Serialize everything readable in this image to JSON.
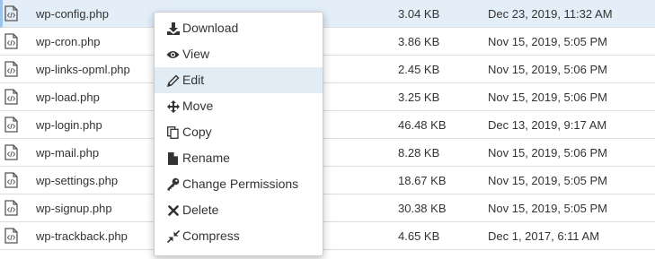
{
  "files": [
    {
      "name": "wp-config.php",
      "size": "3.04 KB",
      "date": "Dec 23, 2019, 11:32 AM",
      "selected": true
    },
    {
      "name": "wp-cron.php",
      "size": "3.86 KB",
      "date": "Nov 15, 2019, 5:05 PM"
    },
    {
      "name": "wp-links-opml.php",
      "size": "2.45 KB",
      "date": "Nov 15, 2019, 5:06 PM"
    },
    {
      "name": "wp-load.php",
      "size": "3.25 KB",
      "date": "Nov 15, 2019, 5:06 PM"
    },
    {
      "name": "wp-login.php",
      "size": "46.48 KB",
      "date": "Dec 13, 2019, 9:17 AM"
    },
    {
      "name": "wp-mail.php",
      "size": "8.28 KB",
      "date": "Nov 15, 2019, 5:06 PM"
    },
    {
      "name": "wp-settings.php",
      "size": "18.67 KB",
      "date": "Nov 15, 2019, 5:05 PM"
    },
    {
      "name": "wp-signup.php",
      "size": "30.38 KB",
      "date": "Nov 15, 2019, 5:05 PM"
    },
    {
      "name": "wp-trackback.php",
      "size": "4.65 KB",
      "date": "Dec 1, 2017, 6:11 AM"
    }
  ],
  "file_icon": "code-file-icon",
  "context_menu": {
    "highlighted": "Edit",
    "items": [
      {
        "label": "Download",
        "icon": "download-icon"
      },
      {
        "label": "View",
        "icon": "eye-icon"
      },
      {
        "label": "Edit",
        "icon": "pencil-icon"
      },
      {
        "label": "Move",
        "icon": "move-arrows-icon"
      },
      {
        "label": "Copy",
        "icon": "copy-icon"
      },
      {
        "label": "Rename",
        "icon": "file-icon"
      },
      {
        "label": "Change Permissions",
        "icon": "key-icon"
      },
      {
        "label": "Delete",
        "icon": "x-icon"
      },
      {
        "label": "Compress",
        "icon": "compress-icon"
      }
    ]
  },
  "colors": {
    "selected_row_bg": "#e3eef9",
    "menu_highlight_bg": "#e1ecf4",
    "row_border": "#dddddd",
    "file_icon": "#555555"
  }
}
